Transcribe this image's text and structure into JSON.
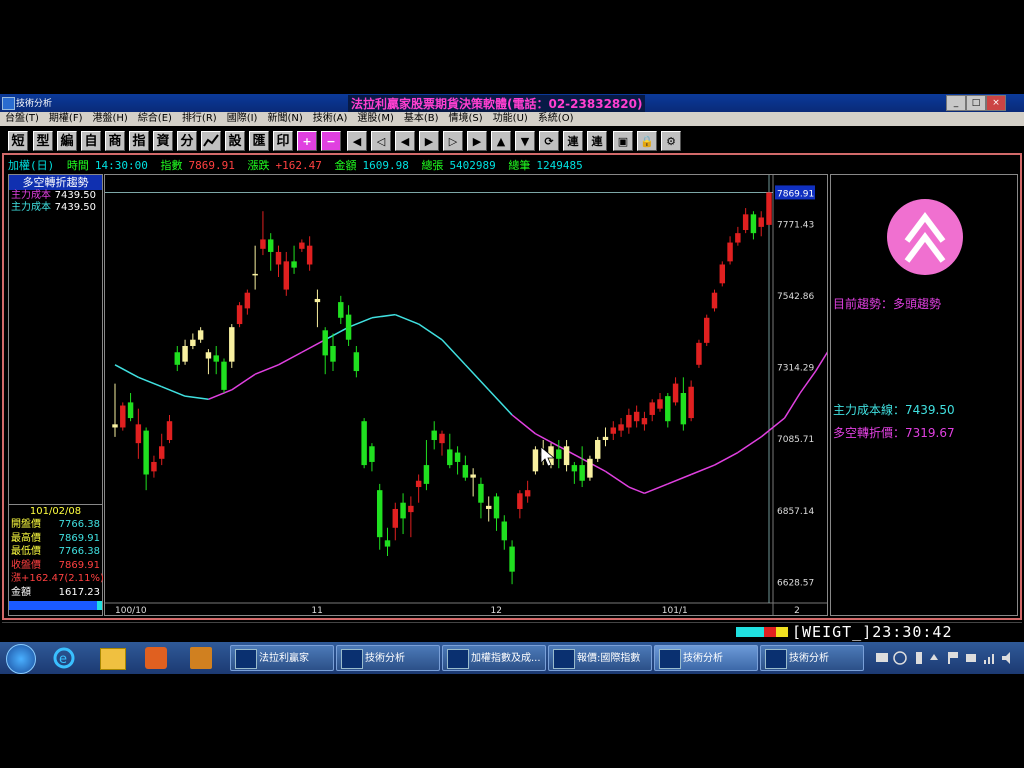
{
  "window": {
    "title": "技術分析",
    "app_title": "法拉利贏家股票期貨決策軟體(電話：02-23832820)",
    "min_label": "_",
    "max_label": "□",
    "close_label": "×"
  },
  "menu": [
    "台盤(T)",
    "期權(F)",
    "港盤(H)",
    "綜合(E)",
    "排行(R)",
    "國際(I)",
    "新聞(N)",
    "技術(A)",
    "選股(M)",
    "基本(B)",
    "情境(S)",
    "功能(U)",
    "系統(O)"
  ],
  "toolbar_text": [
    "短",
    "型",
    "編",
    "自",
    "商",
    "指",
    "資",
    "分"
  ],
  "toolbar_text2": [
    "設",
    "匯",
    "印"
  ],
  "toolbar_icons": [
    "chart-icon",
    "plus-icon",
    "minus-icon",
    "first-icon",
    "prev2-icon",
    "prev-icon",
    "next-icon",
    "next2-icon",
    "last-icon",
    "up-icon",
    "down-icon",
    "refresh-icon",
    "link-icon",
    "link2-icon",
    "window-icon",
    "lock-icon",
    "tools-icon"
  ],
  "infobar": {
    "symbol": "加權(日)",
    "time_label": "時間",
    "time": "14:30:00",
    "index_label": "指數",
    "index": "7869.91",
    "change_label": "漲跌",
    "change": "+162.47",
    "amount_label": "金額",
    "amount": "1609.98",
    "volume_label": "總張",
    "volume": "5402989",
    "trades_label": "總筆",
    "trades": "1249485"
  },
  "leftpanel": {
    "header": "多空轉折趨勢",
    "row1_label": "主力成本",
    "row1_value": "7439.50",
    "row2_label": "主力成本",
    "row2_value": "7439.50",
    "date": "101/02/08",
    "quotes": [
      {
        "label": "開盤價",
        "value": "7766.38"
      },
      {
        "label": "最高價",
        "value": "7869.91"
      },
      {
        "label": "最低價",
        "value": "7766.38"
      },
      {
        "label": "收盤價",
        "value": "7869.91"
      },
      {
        "label": "漲",
        "value": "+162.47(2.11%)"
      },
      {
        "label": "金額",
        "value": "1617.23"
      }
    ]
  },
  "rightpanel": {
    "trend_label": "目前趨勢：多頭趨勢",
    "cost_line": "主力成本線：7439.50",
    "turn_price": "多空轉折價：7319.67"
  },
  "chart_data": {
    "type": "candlestick",
    "y_ticks": [
      "7869.91",
      "7771.43",
      "7542.86",
      "7314.29",
      "7085.71",
      "6857.14",
      "6628.57"
    ],
    "ylim": [
      6560,
      7900
    ],
    "x_tick_labels": [
      "100/10",
      "11",
      "12",
      "101/1",
      "2"
    ],
    "x_tick_index": [
      0,
      26,
      49,
      71,
      88
    ],
    "colors": {
      "up": "#e02020",
      "down": "#20e020",
      "neutral": "#f8f0a0",
      "ma_above": "#40e0e0",
      "ma_below": "#e040e0"
    },
    "candles": [
      [
        7130,
        7260,
        7090,
        7120
      ],
      [
        7120,
        7200,
        7110,
        7190
      ],
      [
        7200,
        7230,
        7140,
        7150
      ],
      [
        7070,
        7180,
        7020,
        7130
      ],
      [
        7110,
        7120,
        6920,
        6970
      ],
      [
        6980,
        7030,
        6960,
        7010
      ],
      [
        7020,
        7100,
        7000,
        7060
      ],
      [
        7080,
        7160,
        7070,
        7140
      ],
      [
        7360,
        7380,
        7300,
        7320
      ],
      [
        7330,
        7400,
        7320,
        7380
      ],
      [
        7380,
        7420,
        7370,
        7400
      ],
      [
        7400,
        7440,
        7390,
        7430
      ],
      [
        7340,
        7370,
        7290,
        7360
      ],
      [
        7350,
        7380,
        7290,
        7330
      ],
      [
        7330,
        7340,
        7230,
        7240
      ],
      [
        7330,
        7450,
        7310,
        7440
      ],
      [
        7450,
        7520,
        7440,
        7510
      ],
      [
        7500,
        7560,
        7480,
        7550
      ],
      [
        7610,
        7700,
        7560,
        7610
      ],
      [
        7690,
        7810,
        7670,
        7720
      ],
      [
        7720,
        7740,
        7620,
        7680
      ],
      [
        7640,
        7700,
        7600,
        7680
      ],
      [
        7560,
        7680,
        7540,
        7650
      ],
      [
        7650,
        7700,
        7610,
        7630
      ],
      [
        7690,
        7720,
        7680,
        7710
      ],
      [
        7640,
        7730,
        7620,
        7700
      ],
      [
        7530,
        7560,
        7440,
        7520
      ],
      [
        7430,
        7440,
        7290,
        7350
      ],
      [
        7380,
        7420,
        7300,
        7330
      ],
      [
        7520,
        7540,
        7450,
        7470
      ],
      [
        7480,
        7510,
        7380,
        7400
      ],
      [
        7360,
        7380,
        7280,
        7300
      ],
      [
        7140,
        7150,
        6990,
        7000
      ],
      [
        7060,
        7070,
        6980,
        7010
      ],
      [
        6920,
        6940,
        6730,
        6770
      ],
      [
        6760,
        6800,
        6710,
        6740
      ],
      [
        6800,
        6880,
        6760,
        6860
      ],
      [
        6880,
        6910,
        6780,
        6830
      ],
      [
        6850,
        6900,
        6770,
        6870
      ],
      [
        6930,
        6970,
        6880,
        6950
      ],
      [
        7000,
        7080,
        6920,
        6940
      ],
      [
        7110,
        7140,
        7050,
        7080
      ],
      [
        7070,
        7110,
        7030,
        7100
      ],
      [
        7050,
        7100,
        6990,
        7000
      ],
      [
        7040,
        7060,
        6970,
        7010
      ],
      [
        7000,
        7030,
        6950,
        6960
      ],
      [
        6960,
        6990,
        6900,
        6970
      ],
      [
        6940,
        6960,
        6830,
        6880
      ],
      [
        6870,
        6900,
        6820,
        6860
      ],
      [
        6900,
        6910,
        6790,
        6830
      ],
      [
        6820,
        6840,
        6730,
        6760
      ],
      [
        6740,
        6760,
        6620,
        6660
      ],
      [
        6860,
        6920,
        6830,
        6910
      ],
      [
        6900,
        6950,
        6880,
        6920
      ],
      [
        6980,
        7060,
        6970,
        7050
      ],
      [
        7040,
        7080,
        7000,
        7030
      ],
      [
        7000,
        7070,
        6990,
        7060
      ],
      [
        7050,
        7080,
        6990,
        7020
      ],
      [
        7000,
        7080,
        6980,
        7060
      ],
      [
        7000,
        7010,
        6940,
        6980
      ],
      [
        7000,
        7060,
        6930,
        6950
      ],
      [
        6960,
        7030,
        6950,
        7020
      ],
      [
        7020,
        7090,
        7010,
        7080
      ],
      [
        7080,
        7120,
        7060,
        7090
      ],
      [
        7100,
        7140,
        7080,
        7120
      ],
      [
        7110,
        7150,
        7090,
        7130
      ],
      [
        7120,
        7180,
        7100,
        7160
      ],
      [
        7140,
        7190,
        7120,
        7170
      ],
      [
        7130,
        7170,
        7110,
        7150
      ],
      [
        7160,
        7210,
        7140,
        7200
      ],
      [
        7180,
        7230,
        7170,
        7210
      ],
      [
        7220,
        7230,
        7120,
        7140
      ],
      [
        7200,
        7280,
        7190,
        7260
      ],
      [
        7230,
        7280,
        7110,
        7130
      ],
      [
        7150,
        7270,
        7140,
        7250
      ],
      [
        7320,
        7400,
        7310,
        7390
      ],
      [
        7390,
        7480,
        7380,
        7470
      ],
      [
        7500,
        7560,
        7490,
        7550
      ],
      [
        7580,
        7650,
        7570,
        7640
      ],
      [
        7650,
        7730,
        7640,
        7710
      ],
      [
        7710,
        7760,
        7700,
        7740
      ],
      [
        7750,
        7820,
        7740,
        7800
      ],
      [
        7800,
        7810,
        7720,
        7740
      ],
      [
        7760,
        7810,
        7730,
        7790
      ],
      [
        7766.38,
        7869.91,
        7766.38,
        7869.91
      ]
    ],
    "ma": [
      [
        0,
        7320
      ],
      [
        3,
        7280
      ],
      [
        6,
        7250
      ],
      [
        9,
        7220
      ],
      [
        12,
        7210
      ],
      [
        15,
        7240
      ],
      [
        18,
        7290
      ],
      [
        21,
        7320
      ],
      [
        24,
        7360
      ],
      [
        27,
        7400
      ],
      [
        30,
        7440
      ],
      [
        33,
        7470
      ],
      [
        36,
        7480
      ],
      [
        39,
        7450
      ],
      [
        42,
        7400
      ],
      [
        45,
        7320
      ],
      [
        48,
        7240
      ],
      [
        51,
        7160
      ],
      [
        54,
        7100
      ],
      [
        57,
        7060
      ],
      [
        60,
        7020
      ],
      [
        63,
        6980
      ],
      [
        66,
        6930
      ],
      [
        68,
        6910
      ],
      [
        71,
        6940
      ],
      [
        74,
        6970
      ],
      [
        77,
        7000
      ],
      [
        80,
        7040
      ],
      [
        83,
        7090
      ],
      [
        86,
        7150
      ],
      [
        88,
        7230
      ],
      [
        90,
        7300
      ],
      [
        92,
        7380
      ],
      [
        94,
        7460
      ],
      [
        95,
        7540
      ]
    ],
    "ma_switch_index": 18,
    "last_price_tag": "7869.91"
  },
  "status": {
    "weigt": "[WEIGT_",
    "clock": "]23:30:42"
  },
  "taskbar": {
    "items": [
      "法拉利贏家",
      "技術分析",
      "加權指數及成...",
      "報價:國際指數",
      "技術分析",
      "技術分析"
    ]
  }
}
